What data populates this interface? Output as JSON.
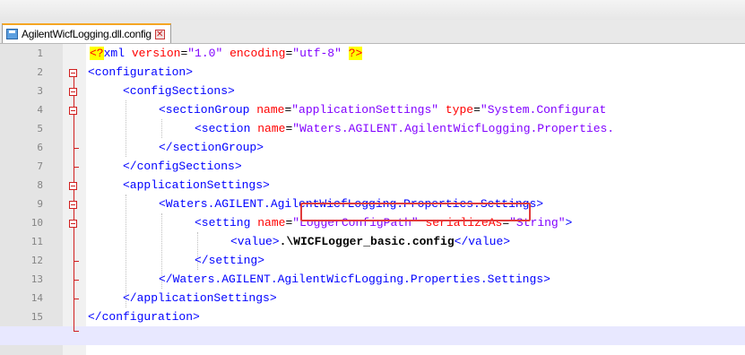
{
  "tab": {
    "filename": "AgilentWicfLogging.dll.config",
    "close_glyph": "✕"
  },
  "lines": [
    {
      "num": "1"
    },
    {
      "num": "2"
    },
    {
      "num": "3"
    },
    {
      "num": "4"
    },
    {
      "num": "5"
    },
    {
      "num": "6"
    },
    {
      "num": "7"
    },
    {
      "num": "8"
    },
    {
      "num": "9"
    },
    {
      "num": "10"
    },
    {
      "num": "11"
    },
    {
      "num": "12"
    },
    {
      "num": "13"
    },
    {
      "num": "14"
    },
    {
      "num": "15"
    }
  ],
  "code": {
    "l1": {
      "open": "<?",
      "name": "xml",
      "attr1": " version",
      "eq1": "=",
      "val1": "\"1.0\"",
      "attr2": " encoding",
      "eq2": "=",
      "val2": "\"utf-8\"",
      "close": "?>"
    },
    "l2": {
      "text": "<configuration>"
    },
    "l3": {
      "text": "<configSections>"
    },
    "l4": {
      "tag": "<sectionGroup",
      "attr1": " name",
      "eq1": "=",
      "val1": "\"applicationSettings\"",
      "attr2": " type",
      "eq2": "=",
      "val2": "\"System.Configurat"
    },
    "l5": {
      "tag": "<section",
      "attr1": " name",
      "eq1": "=",
      "val1": "\"Waters.AGILENT.AgilentWicfLogging.Properties."
    },
    "l6": {
      "text": "</sectionGroup>"
    },
    "l7": {
      "text": "</configSections>"
    },
    "l8": {
      "text": "<applicationSettings>"
    },
    "l9": {
      "text": "<Waters.AGILENT.AgilentWicfLogging.Properties.Settings>"
    },
    "l10": {
      "tag": "<setting",
      "attr1": " name",
      "eq1": "=",
      "val1": "\"LoggerConfigPath\"",
      "attr2": " serializeAs",
      "eq2": "=",
      "val2": "\"String\"",
      "end": ">"
    },
    "l11": {
      "open": "<value>",
      "value": ".\\WICFLogger_basic.config",
      "close": "</value>"
    },
    "l12": {
      "text": "</setting>"
    },
    "l13": {
      "text": "</Waters.AGILENT.AgilentWicfLogging.Properties.Settings>"
    },
    "l14": {
      "text": "</applicationSettings>"
    },
    "l15": {
      "text": "</configuration>"
    }
  },
  "colors": {
    "tag": "#0000ff",
    "attribute": "#ff0000",
    "attribute_value": "#8000ff",
    "fold_marker": "#d01e1e",
    "current_line": "#e8e8ff",
    "callout_box": "#e03b3b"
  }
}
